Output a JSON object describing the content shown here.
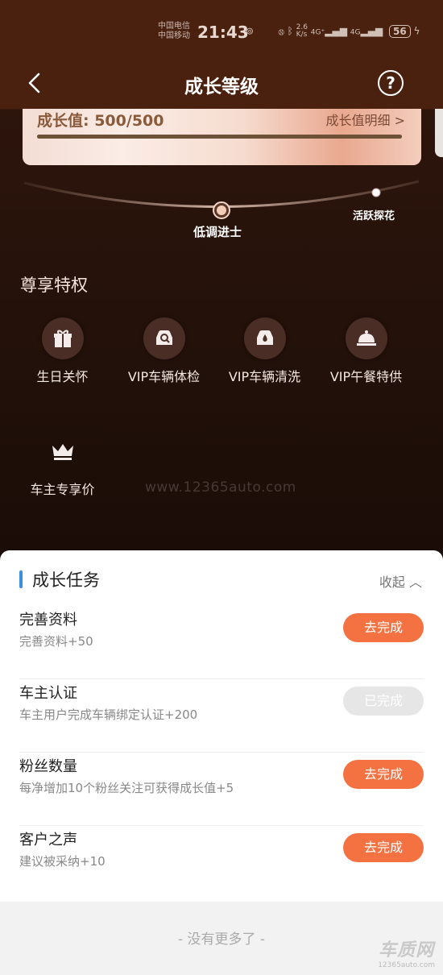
{
  "status": {
    "carrier1": "中国电信",
    "carrier2": "中国移动",
    "time": "21:43",
    "speed_value": "2.6",
    "speed_unit": "K/s",
    "net1": "4G⁺",
    "net2": "4G",
    "battery": "56"
  },
  "nav": {
    "title": "成长等级",
    "help": "?"
  },
  "growth": {
    "label": "成长值: 500/500",
    "detail_link": "成长值明细 >",
    "progress": 1.0
  },
  "levels": {
    "current": "低调进士",
    "next": "活跃探花"
  },
  "privileges": {
    "title": "尊享特权",
    "items": [
      {
        "label": "生日关怀",
        "icon": "gift-icon"
      },
      {
        "label": "VIP车辆体检",
        "icon": "car-inspection-icon"
      },
      {
        "label": "VIP车辆清洗",
        "icon": "car-wash-icon"
      },
      {
        "label": "VIP午餐特供",
        "icon": "dining-bell-icon"
      },
      {
        "label": "车主专享价",
        "icon": "crown-icon"
      }
    ]
  },
  "watermark": "www.12365auto.com",
  "tasks": {
    "title": "成长任务",
    "collapse_label": "收起 ︿",
    "items": [
      {
        "name": "完善资料",
        "desc": "完善资料+50",
        "button": "去完成",
        "state": "active"
      },
      {
        "name": "车主认证",
        "desc": "车主用户完成车辆绑定认证+200",
        "button": "已完成",
        "state": "done"
      },
      {
        "name": "粉丝数量",
        "desc": "每净增加10个粉丝关注可获得成长值+5",
        "button": "去完成",
        "state": "active"
      },
      {
        "name": "客户之声",
        "desc": "建议被采纳+10",
        "button": "去完成",
        "state": "active"
      }
    ]
  },
  "footer": {
    "no_more": "- 没有更多了 -",
    "logo": "车质网",
    "logo_sub": "12365auto.com"
  },
  "colors": {
    "accent": "#f47242",
    "done": "#e6e6e6",
    "header_bar": "#3b8fe0"
  }
}
